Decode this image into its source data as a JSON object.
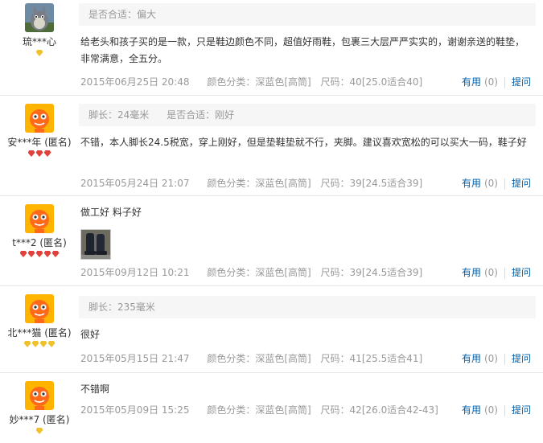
{
  "labels": {
    "useful": "有用",
    "ask": "提问",
    "color_key": "颜色分类：",
    "size_key": "尺码："
  },
  "colors": {
    "link": "#005ea7",
    "meta_bg": "#f6f6f6",
    "muted": "#999999",
    "rank_gold": "#f0c12a",
    "rank_red": "#e2403a"
  },
  "reviews": [
    {
      "user": "琉***心",
      "avatar": "totoro-avatar",
      "rank": "gold",
      "rank_count": 1,
      "meta": [
        "是否合适：偏大"
      ],
      "text": "给老头和孩子买的是一款，只是鞋边颜色不同，超值好雨鞋，包裹三大层严严实实的，谢谢亲送的鞋垫，非常满意，全五分。",
      "date": "2015年06月25日 20:48",
      "color": "深蓝色[高筒]",
      "size": "40[25.0适合40]",
      "useful_count": "(0)"
    },
    {
      "user": "安***年 (匿名)",
      "avatar": "default-avatar",
      "rank": "red",
      "rank_count": 3,
      "meta": [
        "脚长：24毫米",
        "是否合适：刚好"
      ],
      "text": "不错，本人脚长24.5税宽，穿上刚好，但是垫鞋垫就不行，夹脚。建议喜欢宽松的可以买大一码，鞋子好",
      "date": "2015年05月24日 21:07",
      "color": "深蓝色[高筒]",
      "size": "39[24.5适合39]",
      "useful_count": "(0)"
    },
    {
      "user": "t***2 (匿名)",
      "avatar": "default-avatar",
      "rank": "red",
      "rank_count": 5,
      "meta": [],
      "text": "做工好 料子好",
      "date": "2015年09月12日 10:21",
      "color": "深蓝色[高筒]",
      "size": "39[24.5适合39]",
      "useful_count": "(0)"
    },
    {
      "user": "北***猫 (匿名)",
      "avatar": "default-avatar",
      "rank": "gold",
      "rank_count": 4,
      "meta": [
        "脚长：235毫米"
      ],
      "text": "很好",
      "date": "2015年05月15日 21:47",
      "color": "深蓝色[高筒]",
      "size": "41[25.5适合41]",
      "useful_count": "(0)"
    },
    {
      "user": "妙***7 (匿名)",
      "avatar": "default-avatar",
      "rank": "gold",
      "rank_count": 1,
      "meta": [],
      "text": "不错啊",
      "date": "2015年05月09日 15:25",
      "color": "深蓝色[高筒]",
      "size": "42[26.0适合42-43]",
      "useful_count": "(0)"
    }
  ]
}
